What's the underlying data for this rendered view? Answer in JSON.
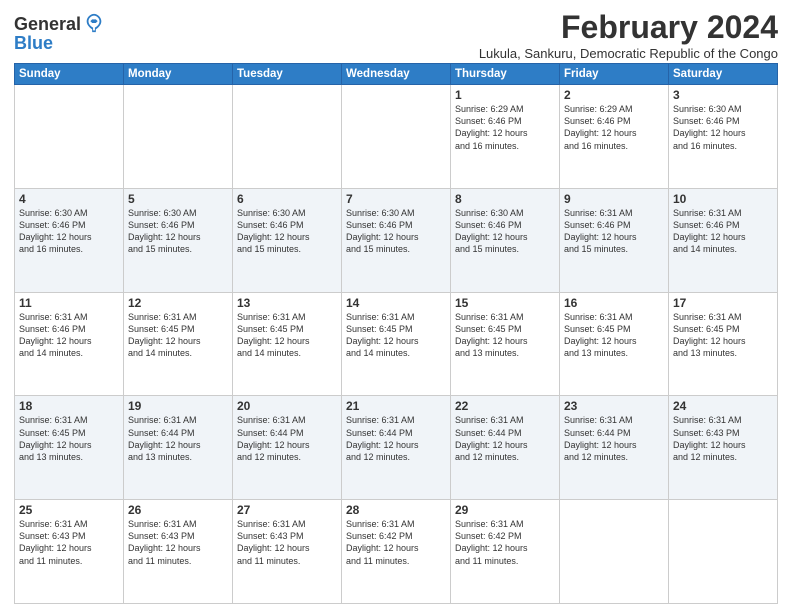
{
  "logo": {
    "line1": "General",
    "line2": "Blue"
  },
  "title": "February 2024",
  "location": "Lukula, Sankuru, Democratic Republic of the Congo",
  "days_of_week": [
    "Sunday",
    "Monday",
    "Tuesday",
    "Wednesday",
    "Thursday",
    "Friday",
    "Saturday"
  ],
  "weeks": [
    [
      {
        "num": "",
        "info": ""
      },
      {
        "num": "",
        "info": ""
      },
      {
        "num": "",
        "info": ""
      },
      {
        "num": "",
        "info": ""
      },
      {
        "num": "1",
        "info": "Sunrise: 6:29 AM\nSunset: 6:46 PM\nDaylight: 12 hours\nand 16 minutes."
      },
      {
        "num": "2",
        "info": "Sunrise: 6:29 AM\nSunset: 6:46 PM\nDaylight: 12 hours\nand 16 minutes."
      },
      {
        "num": "3",
        "info": "Sunrise: 6:30 AM\nSunset: 6:46 PM\nDaylight: 12 hours\nand 16 minutes."
      }
    ],
    [
      {
        "num": "4",
        "info": "Sunrise: 6:30 AM\nSunset: 6:46 PM\nDaylight: 12 hours\nand 16 minutes."
      },
      {
        "num": "5",
        "info": "Sunrise: 6:30 AM\nSunset: 6:46 PM\nDaylight: 12 hours\nand 15 minutes."
      },
      {
        "num": "6",
        "info": "Sunrise: 6:30 AM\nSunset: 6:46 PM\nDaylight: 12 hours\nand 15 minutes."
      },
      {
        "num": "7",
        "info": "Sunrise: 6:30 AM\nSunset: 6:46 PM\nDaylight: 12 hours\nand 15 minutes."
      },
      {
        "num": "8",
        "info": "Sunrise: 6:30 AM\nSunset: 6:46 PM\nDaylight: 12 hours\nand 15 minutes."
      },
      {
        "num": "9",
        "info": "Sunrise: 6:31 AM\nSunset: 6:46 PM\nDaylight: 12 hours\nand 15 minutes."
      },
      {
        "num": "10",
        "info": "Sunrise: 6:31 AM\nSunset: 6:46 PM\nDaylight: 12 hours\nand 14 minutes."
      }
    ],
    [
      {
        "num": "11",
        "info": "Sunrise: 6:31 AM\nSunset: 6:46 PM\nDaylight: 12 hours\nand 14 minutes."
      },
      {
        "num": "12",
        "info": "Sunrise: 6:31 AM\nSunset: 6:45 PM\nDaylight: 12 hours\nand 14 minutes."
      },
      {
        "num": "13",
        "info": "Sunrise: 6:31 AM\nSunset: 6:45 PM\nDaylight: 12 hours\nand 14 minutes."
      },
      {
        "num": "14",
        "info": "Sunrise: 6:31 AM\nSunset: 6:45 PM\nDaylight: 12 hours\nand 14 minutes."
      },
      {
        "num": "15",
        "info": "Sunrise: 6:31 AM\nSunset: 6:45 PM\nDaylight: 12 hours\nand 13 minutes."
      },
      {
        "num": "16",
        "info": "Sunrise: 6:31 AM\nSunset: 6:45 PM\nDaylight: 12 hours\nand 13 minutes."
      },
      {
        "num": "17",
        "info": "Sunrise: 6:31 AM\nSunset: 6:45 PM\nDaylight: 12 hours\nand 13 minutes."
      }
    ],
    [
      {
        "num": "18",
        "info": "Sunrise: 6:31 AM\nSunset: 6:45 PM\nDaylight: 12 hours\nand 13 minutes."
      },
      {
        "num": "19",
        "info": "Sunrise: 6:31 AM\nSunset: 6:44 PM\nDaylight: 12 hours\nand 13 minutes."
      },
      {
        "num": "20",
        "info": "Sunrise: 6:31 AM\nSunset: 6:44 PM\nDaylight: 12 hours\nand 12 minutes."
      },
      {
        "num": "21",
        "info": "Sunrise: 6:31 AM\nSunset: 6:44 PM\nDaylight: 12 hours\nand 12 minutes."
      },
      {
        "num": "22",
        "info": "Sunrise: 6:31 AM\nSunset: 6:44 PM\nDaylight: 12 hours\nand 12 minutes."
      },
      {
        "num": "23",
        "info": "Sunrise: 6:31 AM\nSunset: 6:44 PM\nDaylight: 12 hours\nand 12 minutes."
      },
      {
        "num": "24",
        "info": "Sunrise: 6:31 AM\nSunset: 6:43 PM\nDaylight: 12 hours\nand 12 minutes."
      }
    ],
    [
      {
        "num": "25",
        "info": "Sunrise: 6:31 AM\nSunset: 6:43 PM\nDaylight: 12 hours\nand 11 minutes."
      },
      {
        "num": "26",
        "info": "Sunrise: 6:31 AM\nSunset: 6:43 PM\nDaylight: 12 hours\nand 11 minutes."
      },
      {
        "num": "27",
        "info": "Sunrise: 6:31 AM\nSunset: 6:43 PM\nDaylight: 12 hours\nand 11 minutes."
      },
      {
        "num": "28",
        "info": "Sunrise: 6:31 AM\nSunset: 6:42 PM\nDaylight: 12 hours\nand 11 minutes."
      },
      {
        "num": "29",
        "info": "Sunrise: 6:31 AM\nSunset: 6:42 PM\nDaylight: 12 hours\nand 11 minutes."
      },
      {
        "num": "",
        "info": ""
      },
      {
        "num": "",
        "info": ""
      }
    ]
  ]
}
